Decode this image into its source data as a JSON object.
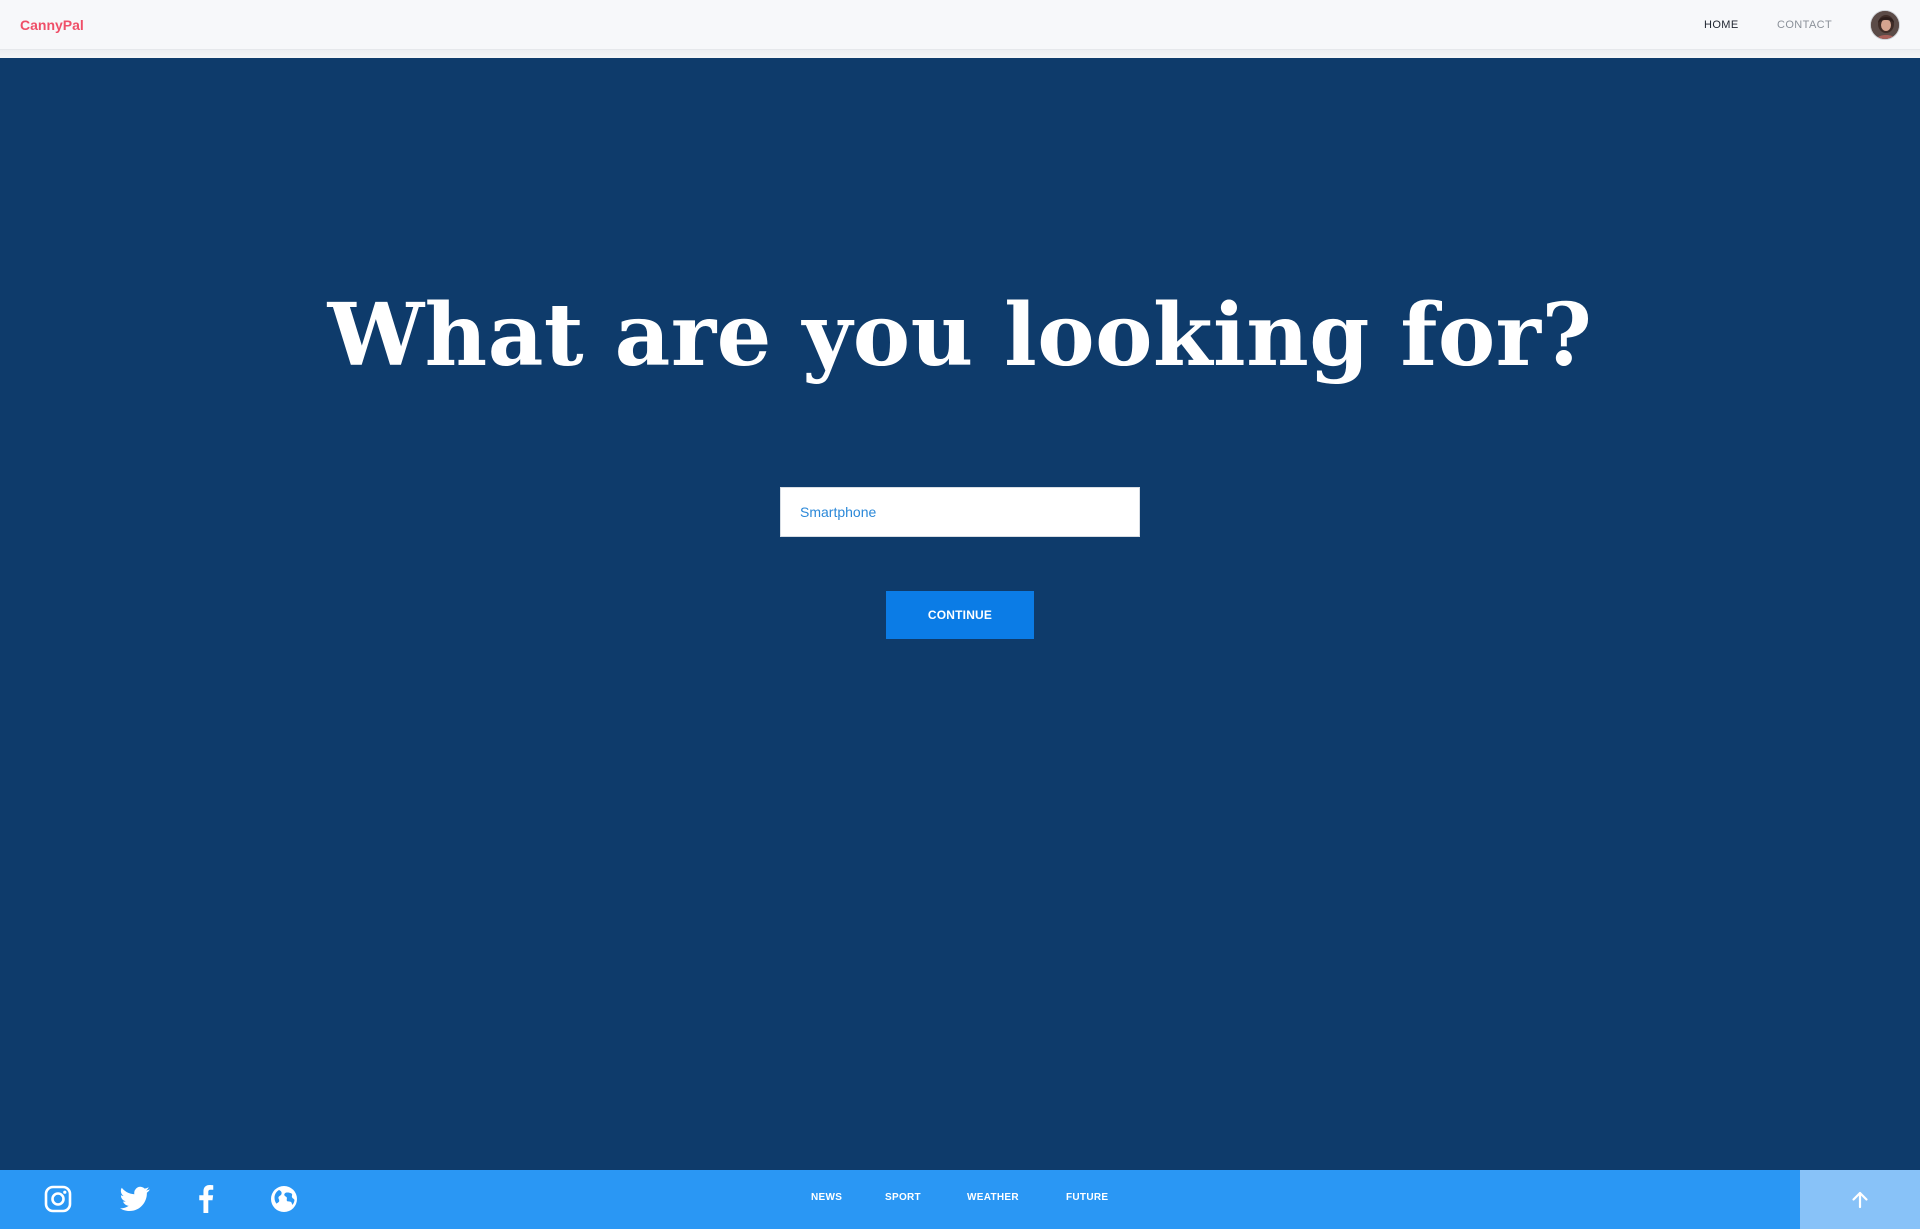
{
  "header": {
    "brand": "CannyPal",
    "nav": [
      {
        "label": "HOME",
        "active": true
      },
      {
        "label": "CONTACT",
        "active": false
      }
    ],
    "avatar_icon": "user-avatar"
  },
  "hero": {
    "title": "What are you looking for?",
    "search": {
      "value": "Smartphone",
      "placeholder": ""
    },
    "continue_label": "CONTINUE"
  },
  "footer": {
    "social_icons": [
      "instagram-icon",
      "twitter-icon",
      "facebook-icon",
      "globe-icon"
    ],
    "links": [
      "NEWS",
      "SPORT",
      "WEATHER",
      "FUTURE"
    ],
    "to_top_icon": "arrow-up-icon"
  },
  "colors": {
    "hero_background": "#0e3b6b",
    "brand": "#ef4f68",
    "button": "#0b7ce6",
    "footer": "#2a97f4",
    "to_top": "#88c2f8",
    "input_text": "#2b88d8"
  }
}
